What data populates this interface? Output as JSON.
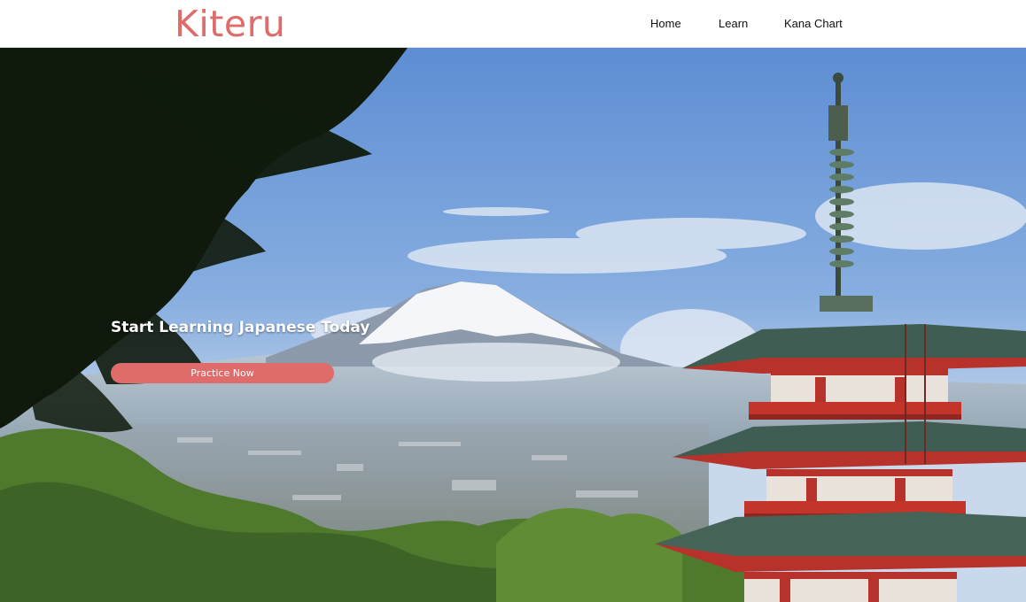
{
  "header": {
    "logo": "Kiteru",
    "nav": [
      {
        "label": "Home"
      },
      {
        "label": "Learn"
      },
      {
        "label": "Kana Chart"
      }
    ]
  },
  "hero": {
    "title": "Start Learning Japanese Today",
    "cta_label": "Practice Now",
    "background_description_icon": "mountain-pagoda-landscape"
  },
  "colors": {
    "accent": "#e06b6b",
    "nav_text": "#111111",
    "sky": "#6e9ad8"
  }
}
